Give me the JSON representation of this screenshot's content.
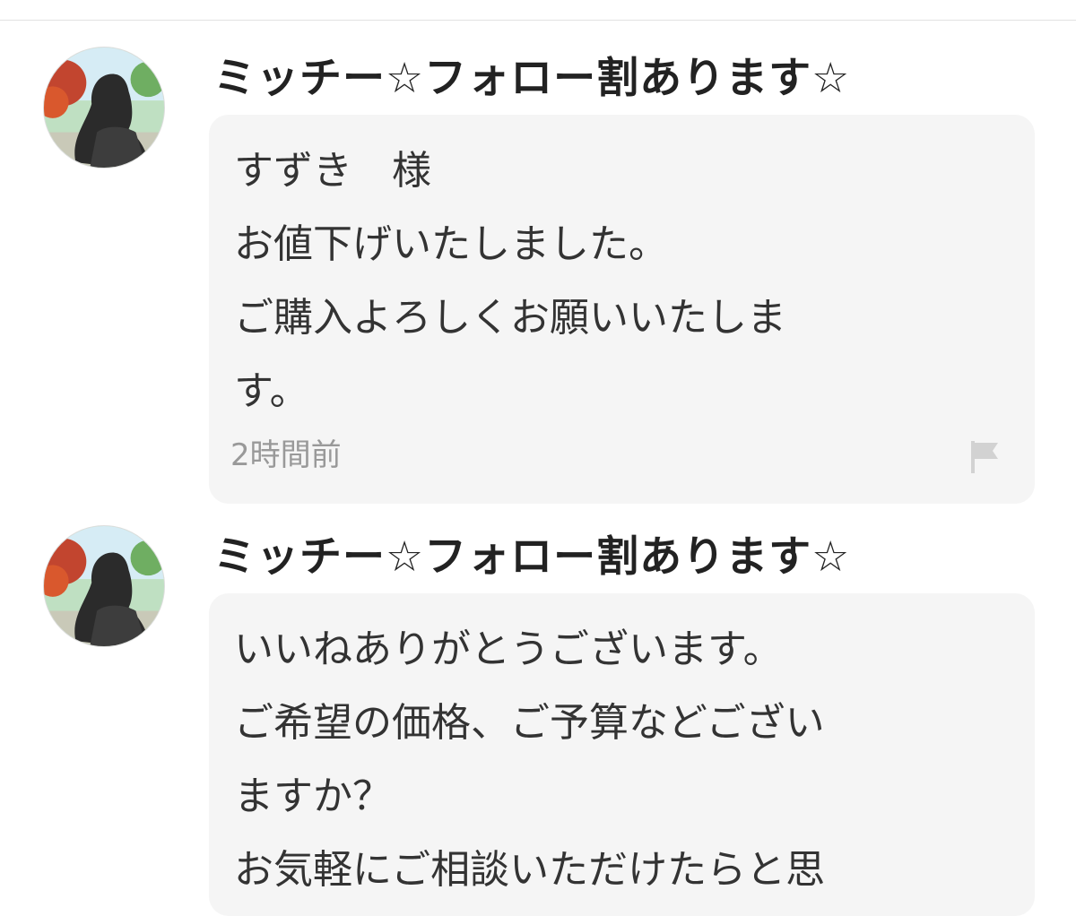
{
  "comments": [
    {
      "username": "ミッチー☆フォロー割あります☆",
      "lines": [
        "すずき　様",
        "お値下げいたしました。",
        "ご購入よろしくお願いいたしま",
        "す。"
      ],
      "timestamp": "2時間前"
    },
    {
      "username": "ミッチー☆フォロー割あります☆",
      "lines": [
        "いいねありがとうございます。",
        "ご希望の価格、ご予算などござい",
        "ますか？",
        "お気軽にご相談いただけたらと思"
      ]
    }
  ],
  "icons": {
    "report": "flag-icon",
    "avatar": "avatar"
  }
}
